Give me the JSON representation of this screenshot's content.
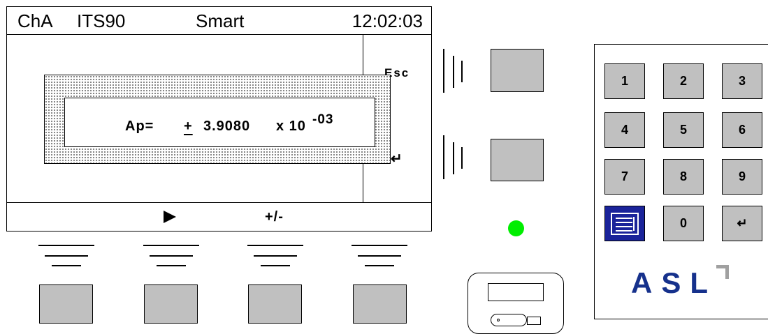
{
  "lcd": {
    "status": {
      "channel": "ChA",
      "scale": "ITS90",
      "mode": "Smart",
      "time": "12:02:03"
    },
    "side_labels": {
      "escape": "Esc",
      "enter": "↵"
    },
    "softkeys": {
      "next_icon": "play-arrow",
      "sign_toggle": "+/-"
    },
    "dialog": {
      "label": "Ap=",
      "sign": "+",
      "mantissa": "3.9080",
      "times_ten": "x 10",
      "exponent": "-03"
    }
  },
  "led": {
    "color": "#00ee00"
  },
  "keypad": {
    "keys": [
      "1",
      "2",
      "3",
      "4",
      "5",
      "6",
      "7",
      "8",
      "9",
      "0"
    ],
    "enter_key": "↵",
    "menu_key_color": "#1a239a",
    "logo": "ASL",
    "logo_color": "#16318c"
  },
  "colors": {
    "key_gray": "#c0c0c0"
  }
}
